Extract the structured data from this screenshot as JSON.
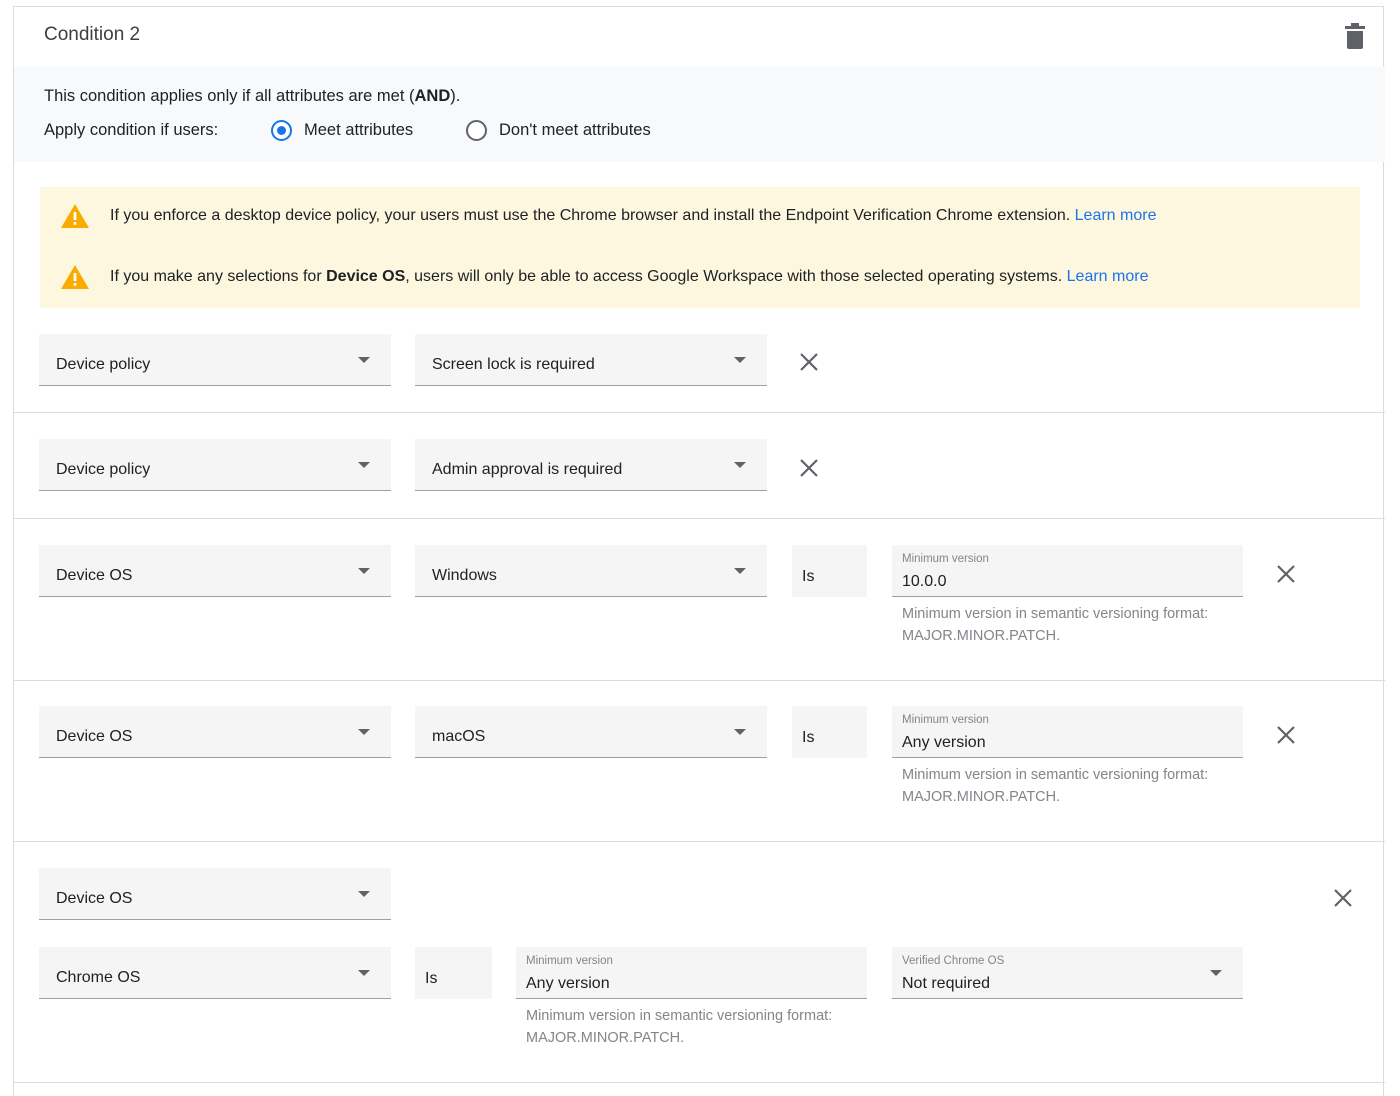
{
  "condition": {
    "title": "Condition 2",
    "description_pre": "This condition applies only if all attributes are met (",
    "description_bold": "AND",
    "description_post": ").",
    "apply_label": "Apply condition if users:",
    "options": [
      {
        "label": "Meet attributes",
        "selected": true
      },
      {
        "label": "Don't meet attributes",
        "selected": false
      }
    ]
  },
  "warnings": [
    {
      "text_pre": "If you enforce a desktop device policy, your users must use the Chrome browser and install the Endpoint Verification Chrome extension.",
      "text_bold": "",
      "text_post": "",
      "link": "Learn more"
    },
    {
      "text_pre": "If you make any selections for ",
      "text_bold": "Device OS",
      "text_post": ", users will only be able to access Google Workspace with those selected operating systems.",
      "link": "Learn more"
    }
  ],
  "rows": [
    {
      "attribute": "Device policy",
      "value": "Screen lock is required"
    },
    {
      "attribute": "Device policy",
      "value": "Admin approval is required"
    },
    {
      "attribute": "Device OS",
      "value": "Windows",
      "operator": "Is",
      "min_label": "Minimum version",
      "min_value": "10.0.0",
      "hint": "Minimum version in semantic versioning format: MAJOR.MINOR.PATCH."
    },
    {
      "attribute": "Device OS",
      "value": "macOS",
      "operator": "Is",
      "min_label": "Minimum version",
      "min_value": "Any version",
      "hint": "Minimum version in semantic versioning format: MAJOR.MINOR.PATCH."
    },
    {
      "attribute": "Device OS",
      "value": "Chrome OS",
      "operator": "Is",
      "min_label": "Minimum version",
      "min_value": "Any version",
      "hint": "Minimum version in semantic versioning format: MAJOR.MINOR.PATCH.",
      "verified_label": "Verified Chrome OS",
      "verified_value": "Not required"
    }
  ],
  "colors": {
    "accent": "#1a73e8",
    "warning": "#f9ab00",
    "warning_bg": "#fef7e0"
  }
}
